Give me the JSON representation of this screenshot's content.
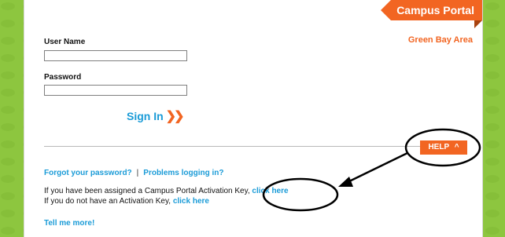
{
  "brand": {
    "title": "Campus Portal",
    "color": "#f26522",
    "district": "Green Bay Area"
  },
  "login": {
    "username_label": "User Name",
    "username_value": "",
    "password_label": "Password",
    "password_value": "",
    "signin_label": "Sign In",
    "signin_icon": "chevron-double-right-icon"
  },
  "help": {
    "label": "HELP",
    "icon": "chevron-up-icon"
  },
  "links": {
    "forgot": "Forgot your password?",
    "separator": "|",
    "problems": "Problems logging in?"
  },
  "activation": {
    "assigned_text": "If you have been assigned a Campus Portal Activation Key,",
    "assigned_link": "click here",
    "no_key_text": "If you do not have an Activation Key,",
    "no_key_link": "click here"
  },
  "tell_more": "Tell me more!",
  "colors": {
    "background": "#8dc63f",
    "link": "#1a9bd7",
    "accent": "#f26522"
  }
}
